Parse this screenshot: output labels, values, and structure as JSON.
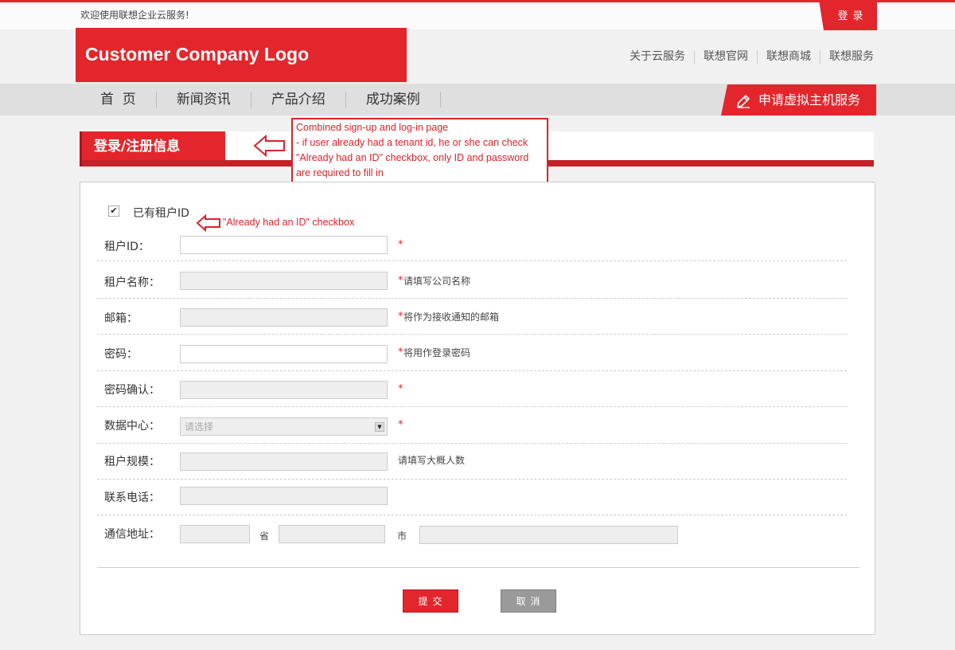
{
  "topbar": {
    "welcome": "欢迎使用联想企业云服务!",
    "login": "登录"
  },
  "header": {
    "logo": "Customer Company Logo",
    "links": [
      "关于云服务",
      "联想官网",
      "联想商城",
      "联想服务"
    ]
  },
  "nav": {
    "items": [
      "首  页",
      "新闻资讯",
      "产品介绍",
      "成功案例"
    ],
    "apply_label": "申请虚拟主机服务",
    "apply_icon": "pencil-icon"
  },
  "section": {
    "title": "登录/注册信息"
  },
  "annotations": {
    "note": "Combined sign-up and log-in page\n- if user already had a tenant id, he or she can check \"Already had an ID\" checkbox, only ID and password are required to fill in\n- if user didn't have a tenant id, he or she can directly register in the same page",
    "checkbox_note": "\"Already had an ID\" checkbox",
    "arrow_color": "#d9232a"
  },
  "form": {
    "has_id_checked": true,
    "has_id_label": "已有租户ID",
    "tenant_id": {
      "label": "租户ID：",
      "value": "",
      "required": "*"
    },
    "tenant_name": {
      "label": "租户名称：",
      "value": "",
      "required": "*",
      "hint": "请填写公司名称"
    },
    "email": {
      "label": "邮箱：",
      "value": "",
      "required": "*",
      "hint": "将作为接收通知的邮箱"
    },
    "password": {
      "label": "密码：",
      "value": "",
      "required": "*",
      "hint": "将用作登录密码"
    },
    "password_confirm": {
      "label": "密码确认：",
      "value": "",
      "required": "*"
    },
    "datacenter": {
      "label": "数据中心：",
      "placeholder": "请选择",
      "required": "*"
    },
    "tenant_size": {
      "label": "租户规模：",
      "value": "",
      "hint": "请填写大概人数"
    },
    "phone": {
      "label": "联系电话：",
      "value": ""
    },
    "address": {
      "label": "通信地址：",
      "province_unit": "省",
      "city_unit": "市"
    },
    "submit": "提交",
    "cancel": "取消"
  },
  "colors": {
    "brand_red": "#e3262c",
    "dark_red": "#c22228",
    "cancel_gray": "#9a9a9a"
  }
}
